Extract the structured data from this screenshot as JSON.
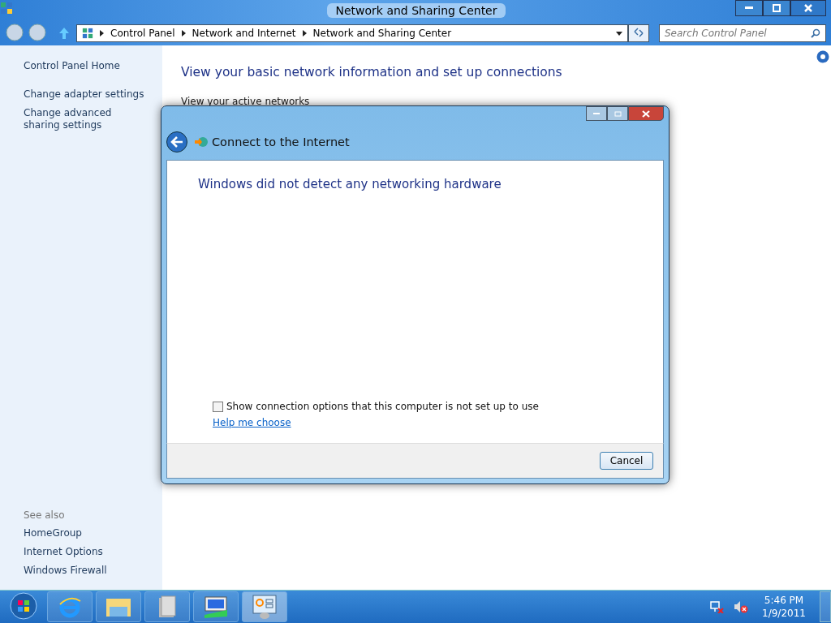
{
  "window": {
    "title": "Network and Sharing Center"
  },
  "address_bar": {
    "crumbs": [
      "Control Panel",
      "Network and Internet",
      "Network and Sharing Center"
    ]
  },
  "search": {
    "placeholder": "Search Control Panel"
  },
  "sidebar": {
    "items": [
      "Control Panel Home",
      "Change adapter settings",
      "Change advanced sharing settings"
    ],
    "see_also_heading": "See also",
    "see_also": [
      "HomeGroup",
      "Internet Options",
      "Windows Firewall"
    ]
  },
  "main": {
    "heading": "View your basic network information and set up connections",
    "subheading": "View your active networks"
  },
  "dialog": {
    "title": "Connect to the Internet",
    "message": "Windows did not detect any networking hardware",
    "checkbox": {
      "label": "Show connection options that this computer is not set up to use",
      "checked": false
    },
    "link": "Help me choose",
    "buttons": [
      "Cancel"
    ]
  },
  "taskbar": {
    "apps": [
      {
        "kind": "browser",
        "selected": false
      },
      {
        "kind": "folder",
        "selected": false
      },
      {
        "kind": "library",
        "selected": false
      },
      {
        "kind": "network",
        "selected": false
      },
      {
        "kind": "panel",
        "selected": true
      }
    ],
    "time": "5:46 PM",
    "date": "1/9/2011"
  }
}
